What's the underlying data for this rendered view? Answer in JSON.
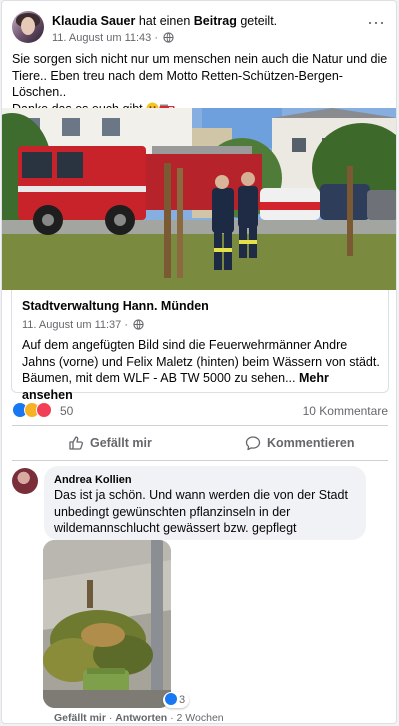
{
  "post": {
    "author": "Klaudia Sauer",
    "shared_text": " hat einen ",
    "shared_object": "Beitrag",
    "shared_suffix": " geteilt.",
    "timestamp": "11. August um 11:43",
    "separator": " · ",
    "text_line1": "Sie sorgen sich nicht nur um menschen nein auch die Natur und die",
    "text_line2": "Tiere.. Eben treu nach dem Motto Retten-Schützen-Bergen-Löschen..",
    "text_line3": "Danke das es euch gibt",
    "more_icon": "more-dots-icon"
  },
  "shared": {
    "page_name": "Stadtverwaltung Hann. Münden",
    "timestamp": "11. August um 11:37",
    "separator": " · ",
    "text": "Auf dem angefügten Bild sind die Feuerwehrmänner Andre Jahns (vorne) und Felix Maletz (hinten) beim Wässern von städt. Bäumen, mit dem WLF - AB TW 5000 zu sehen...",
    "see_more": "Mehr ansehen"
  },
  "stats": {
    "reaction_count": "50",
    "comments_count": "10 Kommentare",
    "reaction_colors": [
      "#1877f2",
      "#f7b125",
      "#f33e58"
    ]
  },
  "actions": {
    "like": "Gefällt mir",
    "comment": "Kommentieren"
  },
  "comment": {
    "author": "Andrea Kollien",
    "text": "Das ist ja schön. Und wann werden die von der Stadt unbedingt gewünschten pflanzinseln in der wildemannschlucht gewässert bzw. gepflegt",
    "likes": "3",
    "like_action": "Gefällt mir",
    "reply_action": "Antworten",
    "age": "2 Wochen",
    "dot": " · "
  },
  "colors": {
    "accent": "#1877f2",
    "muted": "#65676b",
    "bubble": "#f0f2f5"
  }
}
